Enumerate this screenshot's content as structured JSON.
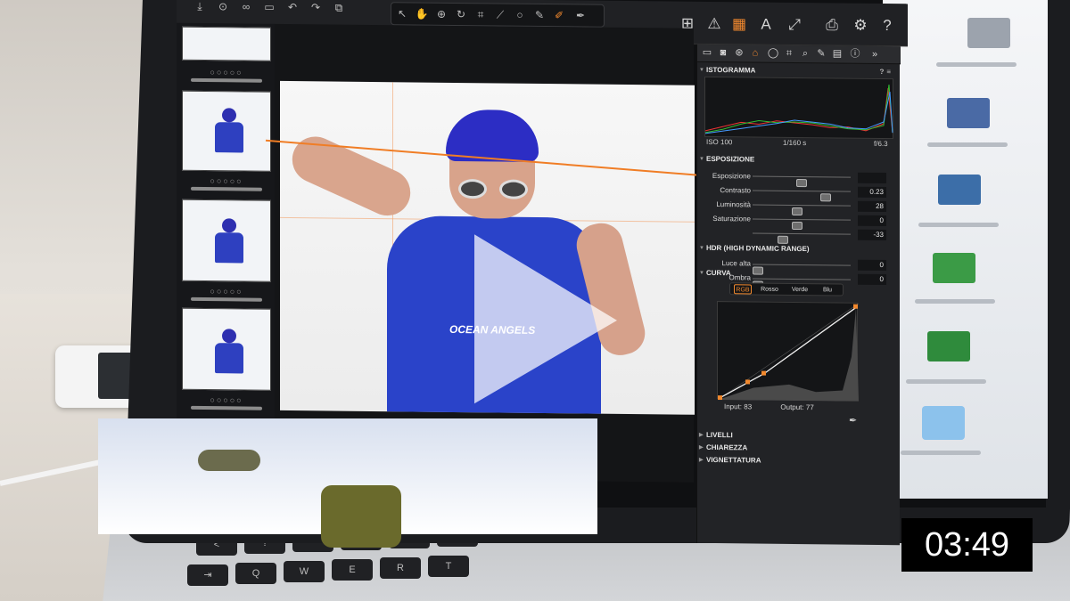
{
  "video": {
    "timestamp": "03:49"
  },
  "app": {
    "toolbar_right_icons": [
      "grid-icon",
      "warning-icon",
      "exposure-icon",
      "text-icon",
      "expand-icon",
      "print-icon",
      "gear-icon",
      "help-icon"
    ],
    "panel_tabs": [
      "folder-icon",
      "camera-icon",
      "color-icon",
      "exposure-tab-icon",
      "lens-icon",
      "crop-icon",
      "focus-icon",
      "brush-icon",
      "metadata-icon",
      "info-icon",
      "more-icon"
    ]
  },
  "panel": {
    "histogram": {
      "title": "ISTOGRAMMA",
      "iso": "ISO 100",
      "shutter": "1/160 s",
      "aperture": "f/6.3"
    },
    "exposure": {
      "title": "ESPOSIZIONE",
      "rows": [
        {
          "label": "Esposizione",
          "value": "",
          "position": 0.5
        },
        {
          "label": "Contrasto",
          "value": "0.23",
          "position": 0.75
        },
        {
          "label": "Luminosità",
          "value": "28",
          "position": 0.45
        },
        {
          "label": "Saturazione",
          "value": "0",
          "position": 0.45
        },
        {
          "label": "",
          "value": "-33",
          "position": 0.3
        }
      ]
    },
    "hdr": {
      "title": "HDR (HIGH DYNAMIC RANGE)",
      "rows": [
        {
          "label": "Luce alta",
          "value": "0",
          "position": 0.02
        },
        {
          "label": "Ombra",
          "value": "0",
          "position": 0.02
        }
      ]
    },
    "curve": {
      "title": "CURVA",
      "tabs": [
        "RGB",
        "Rosso",
        "Verde",
        "Blu"
      ],
      "active_tab": "RGB",
      "input_label": "Input:",
      "input_value": "83",
      "output_label": "Output:",
      "output_value": "77"
    },
    "collapsed_sections": [
      "LIVELLI",
      "CHIAREZZA",
      "VIGNETTATURA"
    ]
  },
  "photo": {
    "shirt_text": "OCEAN ANGELS"
  }
}
